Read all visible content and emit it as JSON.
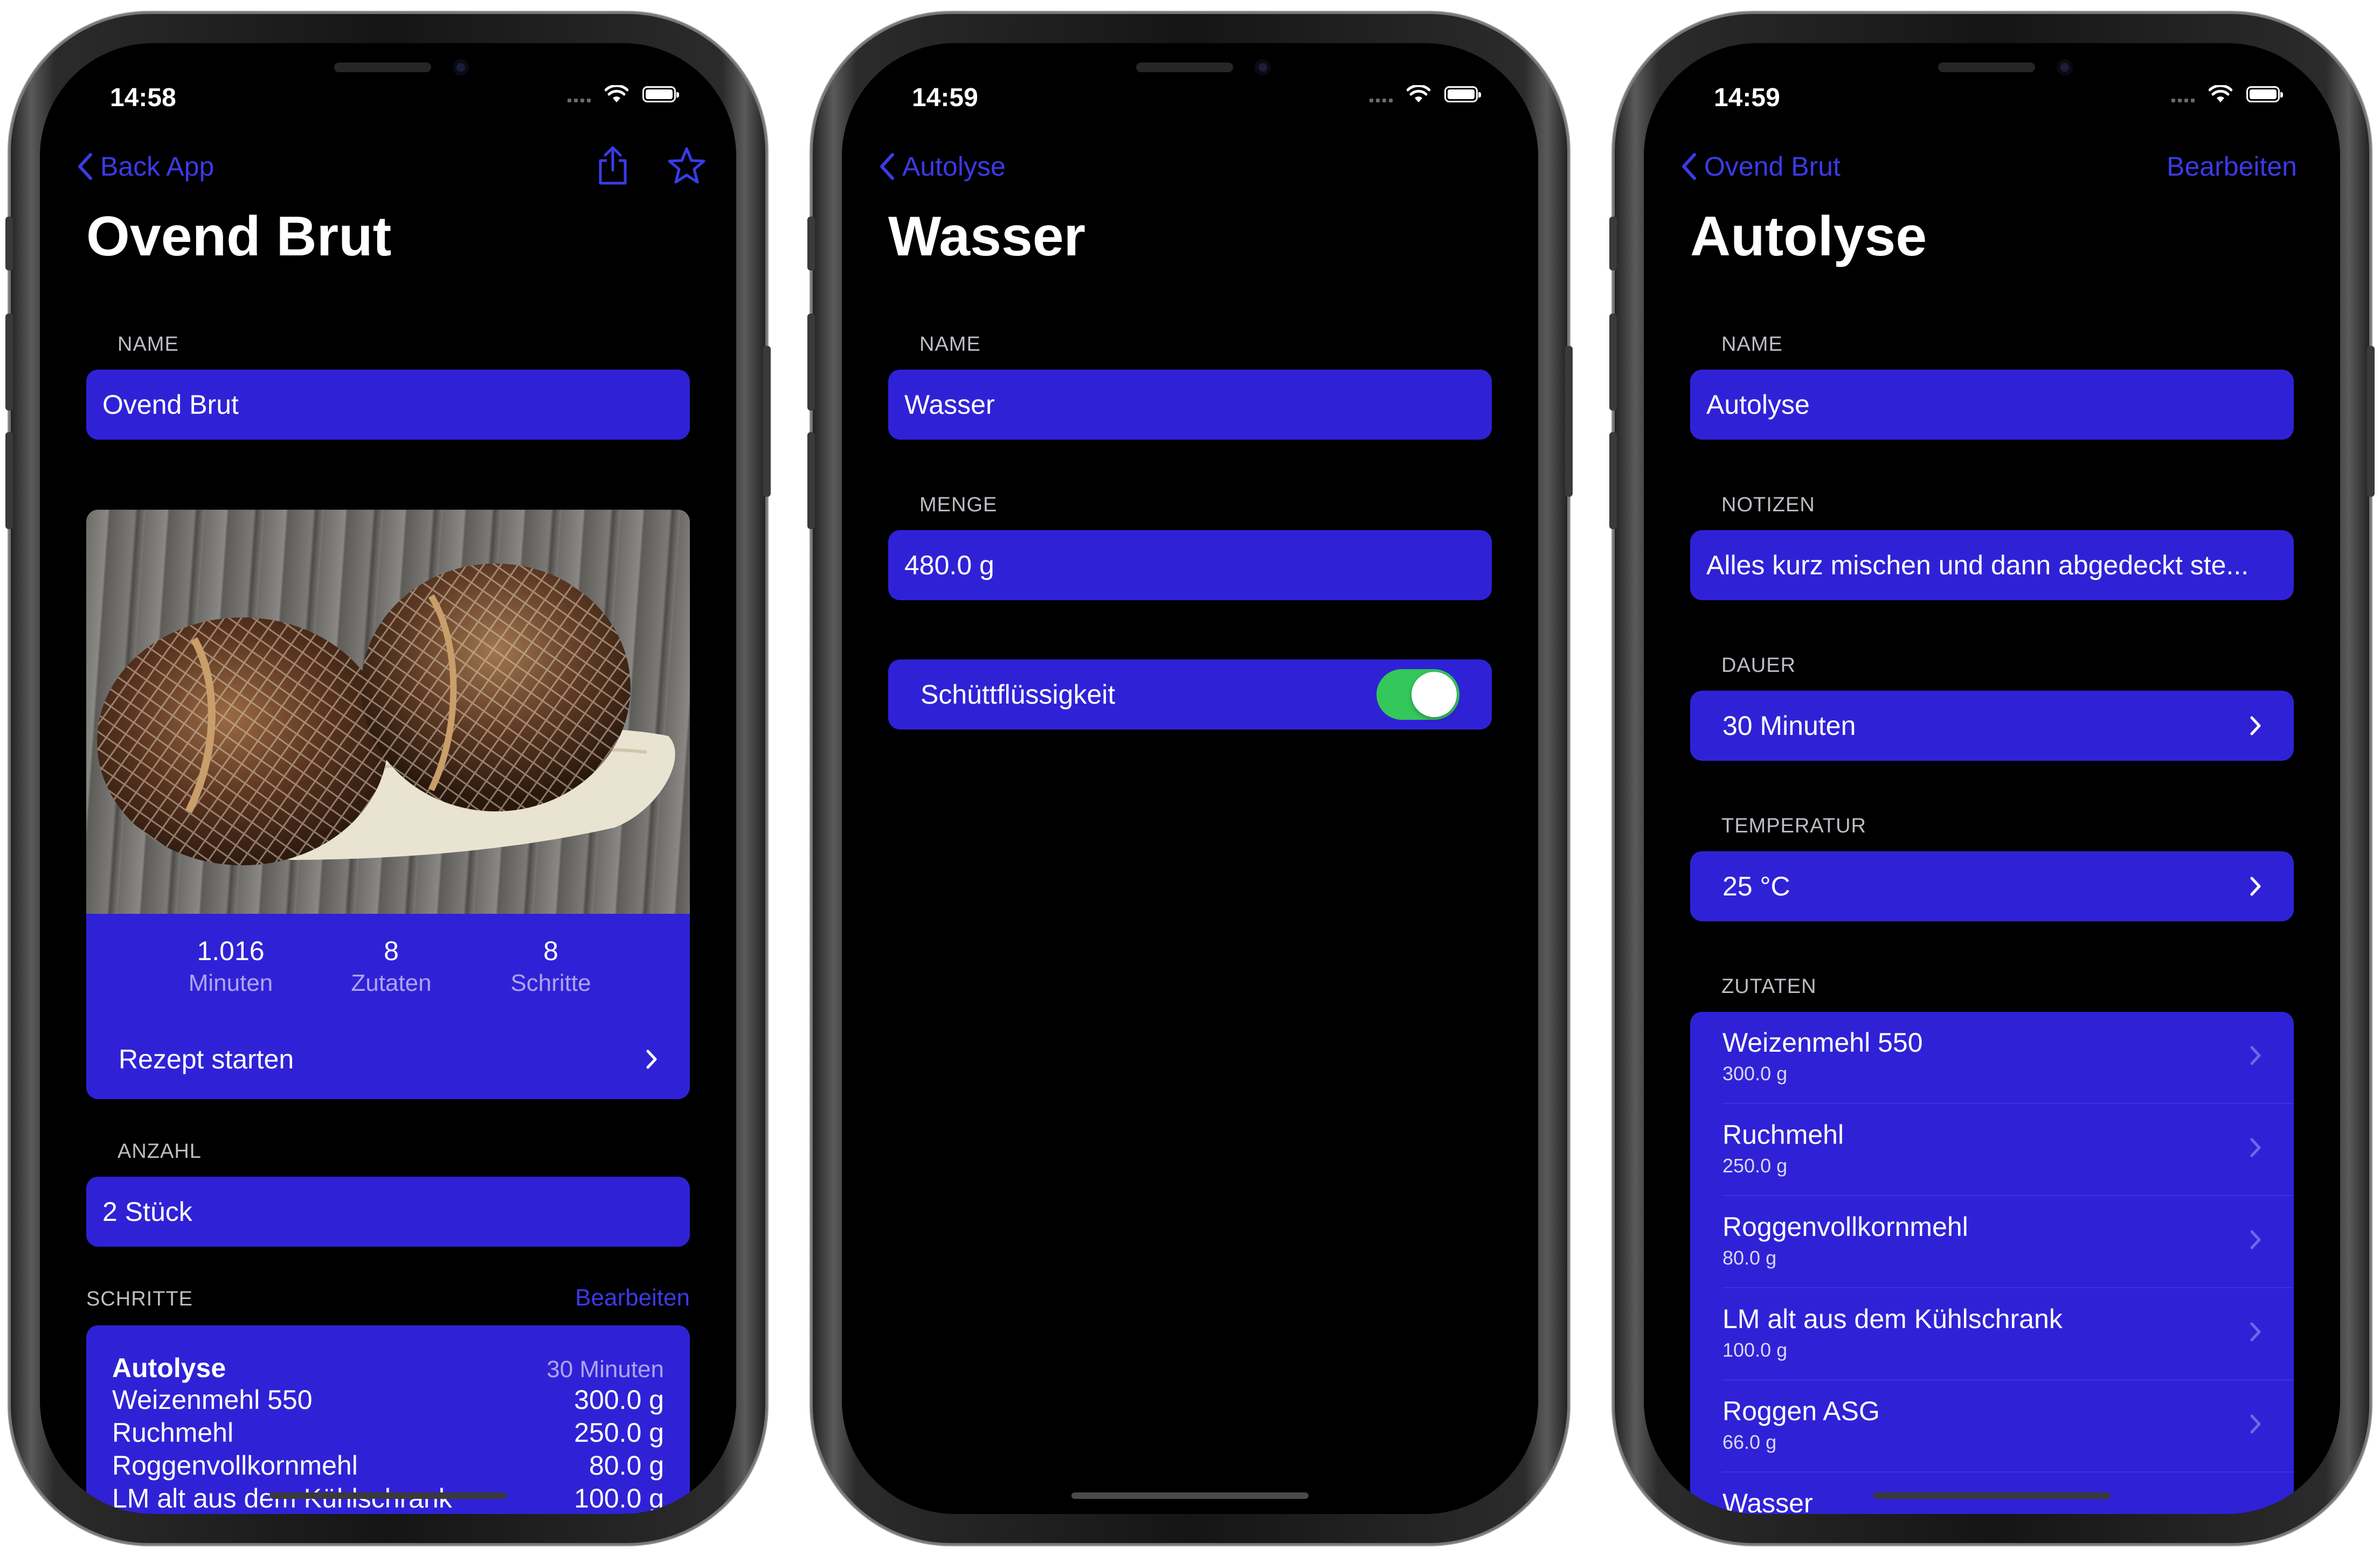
{
  "colors": {
    "accent": "#3a3be8",
    "cell_bg": "#2f22d6",
    "toggle_on": "#34c759",
    "background": "#000000"
  },
  "phones": [
    {
      "time": "14:58",
      "back_label": "Back App",
      "share_icon": "share-icon",
      "star_icon": "star-icon",
      "title": "Ovend Brut",
      "name_label": "NAME",
      "name_value": "Ovend Brut",
      "stats": [
        {
          "value": "1.016",
          "label": "Minuten"
        },
        {
          "value": "8",
          "label": "Zutaten"
        },
        {
          "value": "8",
          "label": "Schritte"
        }
      ],
      "start_label": "Rezept starten",
      "count_label": "ANZAHL",
      "count_value": "2 Stück",
      "steps_label": "SCHRITTE",
      "steps_edit": "Bearbeiten",
      "step_title": "Autolyse",
      "step_duration": "30 Minuten",
      "step_items": [
        {
          "name": "Weizenmehl 550",
          "amount": "300.0 g"
        },
        {
          "name": "Ruchmehl",
          "amount": "250.0 g"
        },
        {
          "name": "Roggenvollkornmehl",
          "amount": "80.0 g"
        },
        {
          "name": "LM alt aus dem Kühlschrank",
          "amount": "100.0 g"
        }
      ]
    },
    {
      "time": "14:59",
      "back_label": "Autolyse",
      "title": "Wasser",
      "name_label": "NAME",
      "name_value": "Wasser",
      "amount_label": "MENGE",
      "amount_value": "480.0 g",
      "toggle_label": "Schüttflüssigkeit",
      "toggle_on": true
    },
    {
      "time": "14:59",
      "back_label": "Ovend Brut",
      "edit_label": "Bearbeiten",
      "title": "Autolyse",
      "name_label": "NAME",
      "name_value": "Autolyse",
      "notes_label": "NOTIZEN",
      "notes_value": "Alles kurz mischen und dann abgedeckt ste...",
      "duration_label": "DAUER",
      "duration_value": "30 Minuten",
      "temp_label": "TEMPERATUR",
      "temp_value": "25 °C",
      "ingredients_label": "ZUTATEN",
      "ingredients": [
        {
          "name": "Weizenmehl 550",
          "amount": "300.0 g"
        },
        {
          "name": "Ruchmehl",
          "amount": "250.0 g"
        },
        {
          "name": "Roggenvollkornmehl",
          "amount": "80.0 g"
        },
        {
          "name": "LM alt aus dem Kühlschrank",
          "amount": "100.0 g"
        },
        {
          "name": "Roggen ASG",
          "amount": "66.0 g"
        },
        {
          "name": "Wasser",
          "amount": ""
        }
      ]
    }
  ]
}
